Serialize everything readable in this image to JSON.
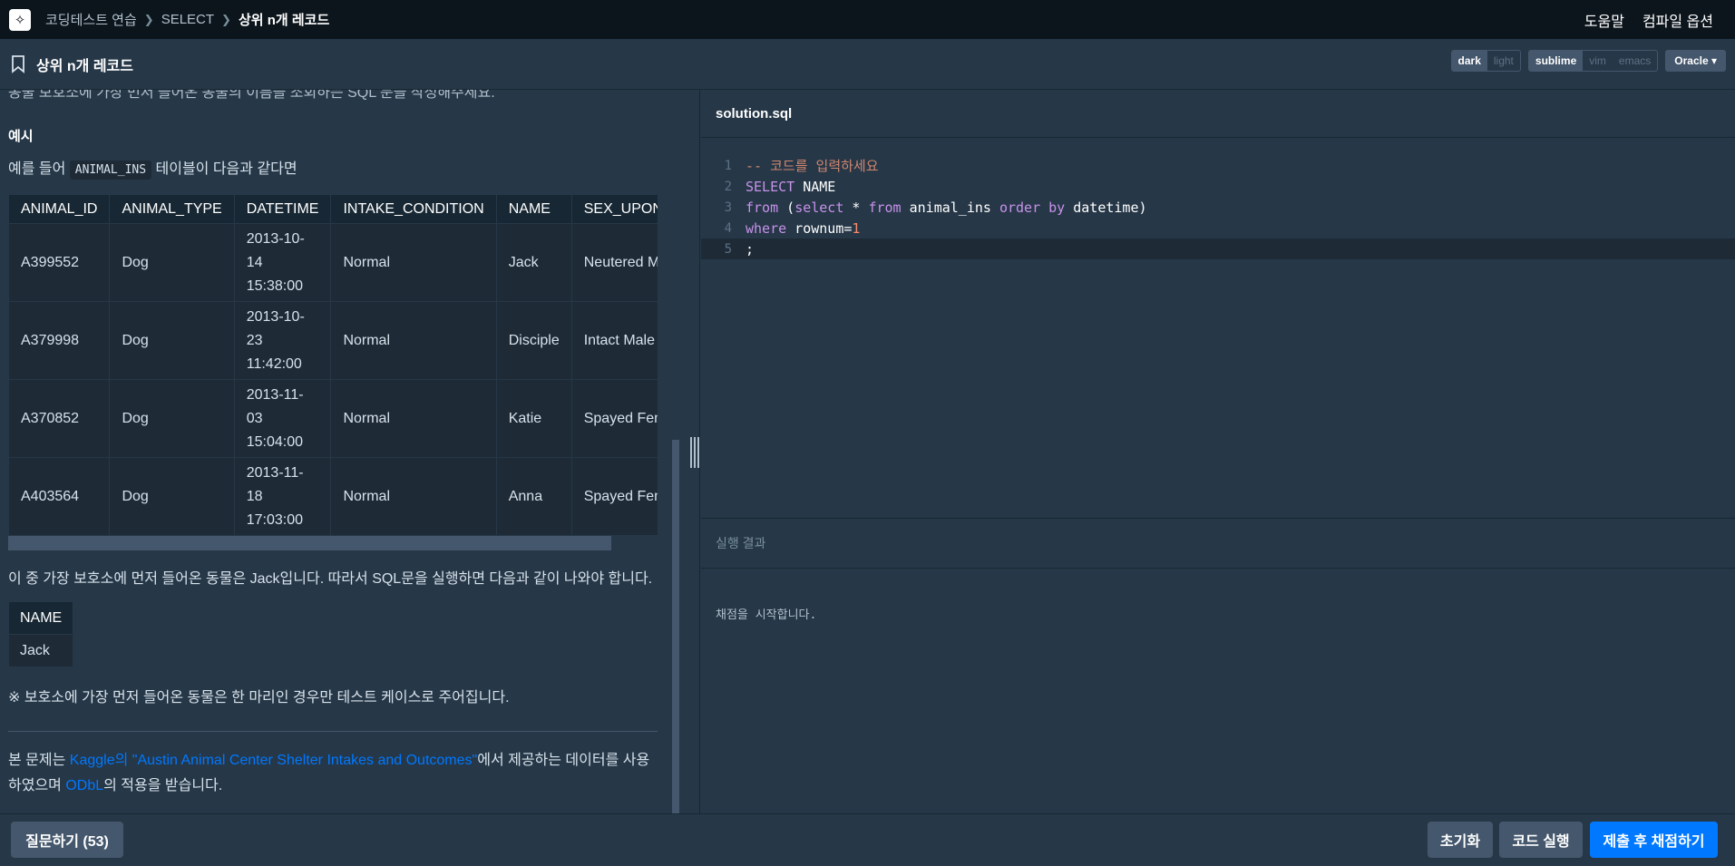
{
  "nav": {
    "breadcrumbs": [
      "코딩테스트 연습",
      "SELECT",
      "상위 n개 레코드"
    ],
    "help": "도움말",
    "compile_options": "컴파일 옵션"
  },
  "header": {
    "title": "상위 n개 레코드",
    "theme": {
      "dark": "dark",
      "light": "light"
    },
    "keymap": {
      "sublime": "sublime",
      "vim": "vim",
      "emacs": "emacs"
    },
    "language": "Oracle"
  },
  "problem": {
    "intro": "동물 보호소에 가장 먼저 들어온 동물의 이름을 조회하는 SQL 문을 작성해주세요.",
    "example_heading": "예시",
    "example_prefix": "예를 들어",
    "table_name": "ANIMAL_INS",
    "example_suffix": "테이블이 다음과 같다면",
    "columns": [
      "ANIMAL_ID",
      "ANIMAL_TYPE",
      "DATETIME",
      "INTAKE_CONDITION",
      "NAME",
      "SEX_UPON_INTAKE"
    ],
    "rows": [
      [
        "A399552",
        "Dog",
        "2013-10-14 15:38:00",
        "Normal",
        "Jack",
        "Neutered Male"
      ],
      [
        "A379998",
        "Dog",
        "2013-10-23 11:42:00",
        "Normal",
        "Disciple",
        "Intact Male"
      ],
      [
        "A370852",
        "Dog",
        "2013-11-03 15:04:00",
        "Normal",
        "Katie",
        "Spayed Female"
      ],
      [
        "A403564",
        "Dog",
        "2013-11-18 17:03:00",
        "Normal",
        "Anna",
        "Spayed Female"
      ]
    ],
    "explain": "이 중 가장 보호소에 먼저 들어온 동물은 Jack입니다. 따라서 SQL문을 실행하면 다음과 같이 나와야 합니다.",
    "result_header": "NAME",
    "result_value": "Jack",
    "note": "※ 보호소에 가장 먼저 들어온 동물은 한 마리인 경우만 테스트 케이스로 주어집니다.",
    "source_prefix": "본 문제는 ",
    "source_link": "Kaggle의 \"Austin Animal Center Shelter Intakes and Outcomes\"",
    "source_mid": "에서 제공하는 데이터를 사용하였으며 ",
    "license_link": "ODbL",
    "source_suffix": "의 적용을 받습니다."
  },
  "editor": {
    "filename": "solution.sql",
    "line_numbers": [
      "1",
      "2",
      "3",
      "4",
      "5"
    ],
    "comment": "-- 코드를 입력하세요",
    "l2_kw": "SELECT",
    "l2_rest": " NAME",
    "l3_kw1": "from",
    "l3_p1": " (",
    "l3_kw2": "select",
    "l3_p2": " * ",
    "l3_kw3": "from",
    "l3_p3": " animal_ins ",
    "l3_kw4": "order",
    "l3_p4": " ",
    "l3_kw5": "by",
    "l3_p5": " datetime)",
    "l4_kw": "where",
    "l4_rest": " rownum=",
    "l4_num": "1",
    "l5": ";"
  },
  "results": {
    "heading": "실행 결과",
    "message": "채점을 시작합니다."
  },
  "footer": {
    "ask": "질문하기 (53)",
    "reset": "초기화",
    "run": "코드 실행",
    "submit": "제출 후 채점하기"
  },
  "colors": {
    "background": "#263747",
    "nav": "#0c151c",
    "accent": "#0078ff",
    "button": "#44576c"
  }
}
